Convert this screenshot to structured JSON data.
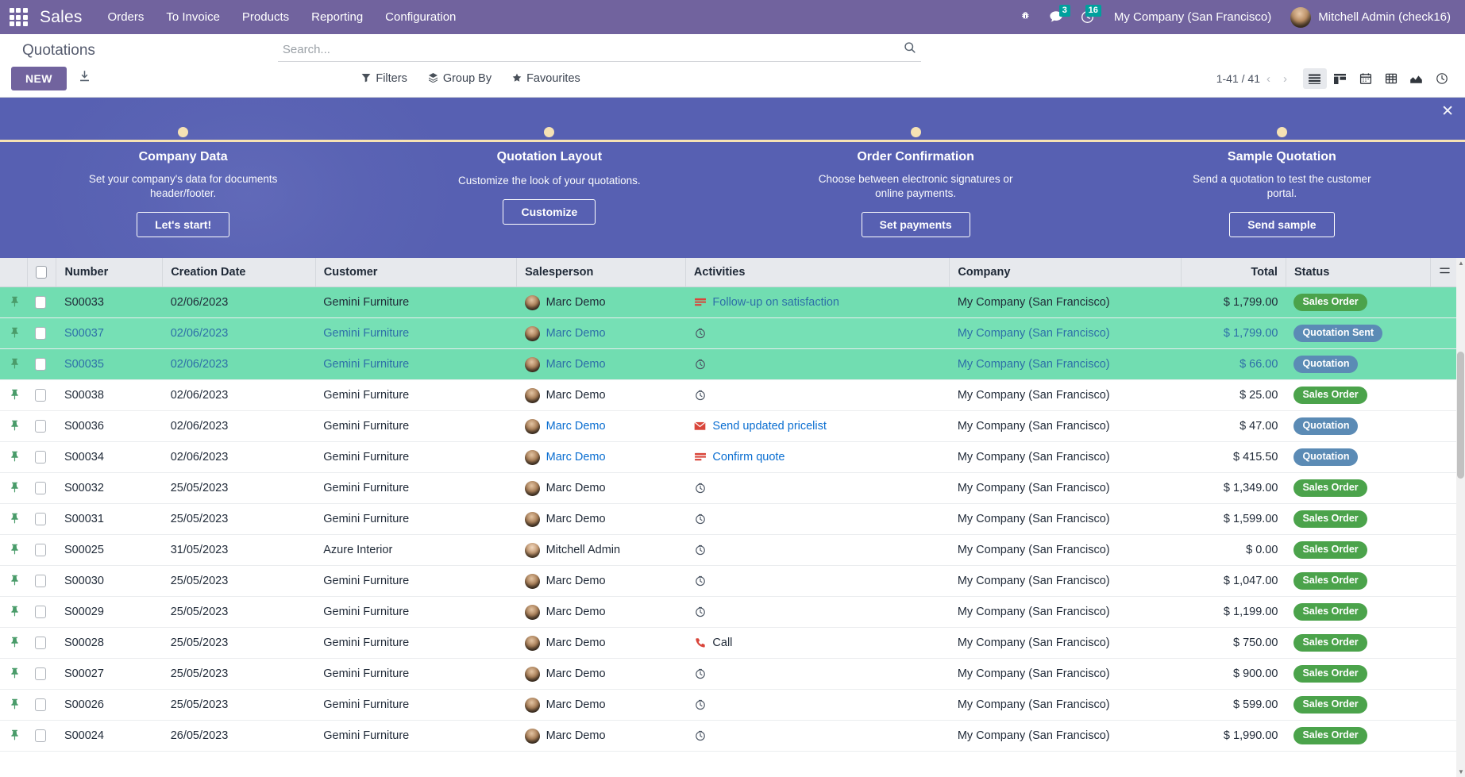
{
  "navbar": {
    "apps_icon": "apps-grid-icon",
    "brand": "Sales",
    "menus": [
      "Orders",
      "To Invoice",
      "Products",
      "Reporting",
      "Configuration"
    ],
    "bug_icon": "bug-icon",
    "messages_icon": "chat-icon",
    "messages_count": "3",
    "activities_icon": "clock-icon",
    "activities_count": "16",
    "company": "My Company (San Francisco)",
    "user": "Mitchell Admin (check16)"
  },
  "control_panel": {
    "breadcrumb": "Quotations",
    "new_label": "NEW",
    "export_icon": "download-icon",
    "search_placeholder": "Search...",
    "search_value": "",
    "search_icon": "search-icon",
    "filters_label": "Filters",
    "group_by_label": "Group By",
    "favourites_label": "Favourites",
    "pager": "1-41 / 41",
    "prev_icon": "chevron-left-icon",
    "next_icon": "chevron-right-icon",
    "views": [
      {
        "name": "list-view",
        "icon": "list-icon",
        "active": true
      },
      {
        "name": "kanban-view",
        "icon": "kanban-icon",
        "active": false
      },
      {
        "name": "calendar-view",
        "icon": "calendar-icon",
        "active": false
      },
      {
        "name": "pivot-view",
        "icon": "pivot-icon",
        "active": false
      },
      {
        "name": "graph-view",
        "icon": "graph-icon",
        "active": false
      },
      {
        "name": "activity-view",
        "icon": "clock-icon",
        "active": false
      }
    ]
  },
  "onboarding": {
    "close_icon": "close-icon",
    "steps": [
      {
        "title": "Company Data",
        "desc": "Set your company's data for documents header/footer.",
        "button": "Let's start!"
      },
      {
        "title": "Quotation Layout",
        "desc": "Customize the look of your quotations.",
        "button": "Customize"
      },
      {
        "title": "Order Confirmation",
        "desc": "Choose between electronic signatures or online payments.",
        "button": "Set payments"
      },
      {
        "title": "Sample Quotation",
        "desc": "Send a quotation to test the customer portal.",
        "button": "Send sample"
      }
    ]
  },
  "table": {
    "columns": [
      "Number",
      "Creation Date",
      "Customer",
      "Salesperson",
      "Activities",
      "Company",
      "Total",
      "Status"
    ],
    "optional_columns_icon": "sliders-icon",
    "select_all_checkbox": "select-all-checkbox",
    "rows": [
      {
        "number": "S00033",
        "date": "02/06/2023",
        "customer": "Gemini Furniture",
        "salesperson": "Marc Demo",
        "activity": "Follow-up on satisfaction",
        "activity_icon": "list-red-icon",
        "company": "My Company (San Francisco)",
        "total": "$ 1,799.00",
        "status": "Sales Order",
        "status_kind": "sales",
        "selected": true
      },
      {
        "number": "S00037",
        "date": "02/06/2023",
        "customer": "Gemini Furniture",
        "salesperson": "Marc Demo",
        "activity": "",
        "activity_icon": "clock-icon",
        "company": "My Company (San Francisco)",
        "total": "$ 1,799.00",
        "status": "Quotation Sent",
        "status_kind": "sent",
        "selected": true
      },
      {
        "number": "S00035",
        "date": "02/06/2023",
        "customer": "Gemini Furniture",
        "salesperson": "Marc Demo",
        "activity": "",
        "activity_icon": "clock-icon",
        "company": "My Company (San Francisco)",
        "total": "$ 66.00",
        "status": "Quotation",
        "status_kind": "quote",
        "selected": true
      },
      {
        "number": "S00038",
        "date": "02/06/2023",
        "customer": "Gemini Furniture",
        "salesperson": "Marc Demo",
        "activity": "",
        "activity_icon": "clock-icon",
        "company": "My Company (San Francisco)",
        "total": "$ 25.00",
        "status": "Sales Order",
        "status_kind": "sales",
        "selected": false
      },
      {
        "number": "S00036",
        "date": "02/06/2023",
        "customer": "Gemini Furniture",
        "salesperson": "Marc Demo",
        "activity": "Send updated pricelist",
        "activity_icon": "mail-red-icon",
        "company": "My Company (San Francisco)",
        "total": "$ 47.00",
        "status": "Quotation",
        "status_kind": "quote",
        "selected": false,
        "link": true
      },
      {
        "number": "S00034",
        "date": "02/06/2023",
        "customer": "Gemini Furniture",
        "salesperson": "Marc Demo",
        "activity": "Confirm quote",
        "activity_icon": "list-red-icon",
        "company": "My Company (San Francisco)",
        "total": "$ 415.50",
        "status": "Quotation",
        "status_kind": "quote",
        "selected": false,
        "link": true
      },
      {
        "number": "S00032",
        "date": "25/05/2023",
        "customer": "Gemini Furniture",
        "salesperson": "Marc Demo",
        "activity": "",
        "activity_icon": "clock-icon",
        "company": "My Company (San Francisco)",
        "total": "$ 1,349.00",
        "status": "Sales Order",
        "status_kind": "sales",
        "selected": false
      },
      {
        "number": "S00031",
        "date": "25/05/2023",
        "customer": "Gemini Furniture",
        "salesperson": "Marc Demo",
        "activity": "",
        "activity_icon": "clock-icon",
        "company": "My Company (San Francisco)",
        "total": "$ 1,599.00",
        "status": "Sales Order",
        "status_kind": "sales",
        "selected": false
      },
      {
        "number": "S00025",
        "date": "31/05/2023",
        "customer": "Azure Interior",
        "salesperson": "Mitchell Admin",
        "activity": "",
        "activity_icon": "clock-icon",
        "company": "My Company (San Francisco)",
        "total": "$ 0.00",
        "status": "Sales Order",
        "status_kind": "sales",
        "selected": false
      },
      {
        "number": "S00030",
        "date": "25/05/2023",
        "customer": "Gemini Furniture",
        "salesperson": "Marc Demo",
        "activity": "",
        "activity_icon": "clock-icon",
        "company": "My Company (San Francisco)",
        "total": "$ 1,047.00",
        "status": "Sales Order",
        "status_kind": "sales",
        "selected": false
      },
      {
        "number": "S00029",
        "date": "25/05/2023",
        "customer": "Gemini Furniture",
        "salesperson": "Marc Demo",
        "activity": "",
        "activity_icon": "clock-icon",
        "company": "My Company (San Francisco)",
        "total": "$ 1,199.00",
        "status": "Sales Order",
        "status_kind": "sales",
        "selected": false
      },
      {
        "number": "S00028",
        "date": "25/05/2023",
        "customer": "Gemini Furniture",
        "salesperson": "Marc Demo",
        "activity": "Call",
        "activity_icon": "phone-red-icon",
        "company": "My Company (San Francisco)",
        "total": "$ 750.00",
        "status": "Sales Order",
        "status_kind": "sales",
        "selected": false
      },
      {
        "number": "S00027",
        "date": "25/05/2023",
        "customer": "Gemini Furniture",
        "salesperson": "Marc Demo",
        "activity": "",
        "activity_icon": "clock-icon",
        "company": "My Company (San Francisco)",
        "total": "$ 900.00",
        "status": "Sales Order",
        "status_kind": "sales",
        "selected": false
      },
      {
        "number": "S00026",
        "date": "25/05/2023",
        "customer": "Gemini Furniture",
        "salesperson": "Marc Demo",
        "activity": "",
        "activity_icon": "clock-icon",
        "company": "My Company (San Francisco)",
        "total": "$ 599.00",
        "status": "Sales Order",
        "status_kind": "sales",
        "selected": false
      },
      {
        "number": "S00024",
        "date": "26/05/2023",
        "customer": "Gemini Furniture",
        "salesperson": "Marc Demo",
        "activity": "",
        "activity_icon": "clock-icon",
        "company": "My Company (San Francisco)",
        "total": "$ 1,990.00",
        "status": "Sales Order",
        "status_kind": "sales",
        "selected": false
      }
    ]
  },
  "colors": {
    "brand_purple": "#71639e",
    "selected_row": "#71ddb1",
    "badge_sales": "#4ba34b",
    "badge_quote": "#5b8bb5",
    "banner_blue": "#5f69ac",
    "accent_cream": "#f6e2b4"
  }
}
